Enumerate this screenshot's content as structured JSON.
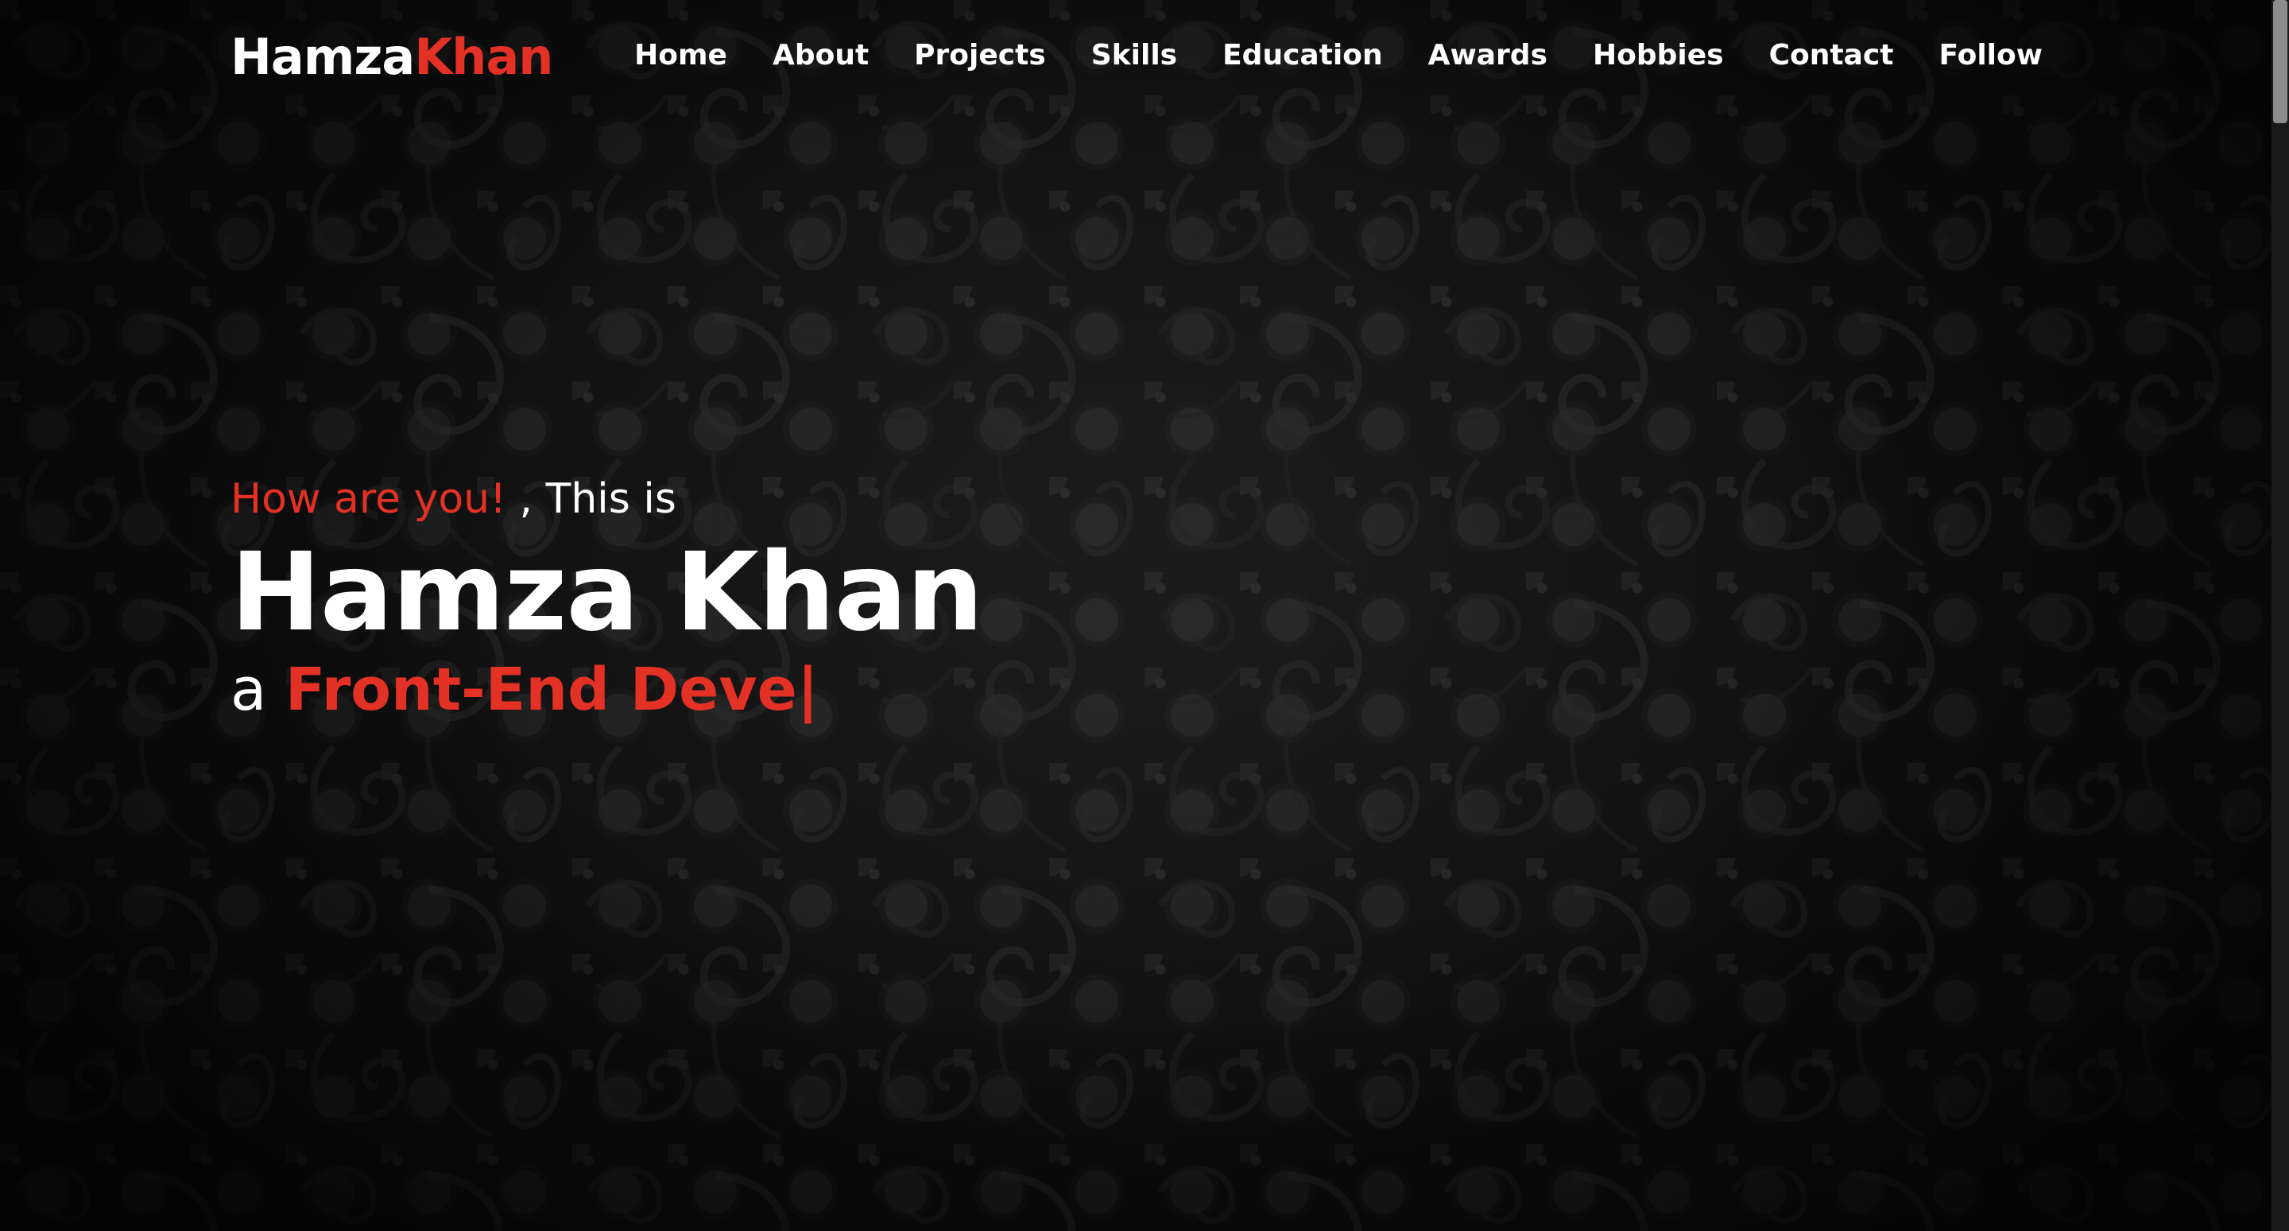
{
  "brand": {
    "first": "Hamza",
    "second": "Khan"
  },
  "nav": {
    "items": [
      {
        "label": "Home"
      },
      {
        "label": "About"
      },
      {
        "label": "Projects"
      },
      {
        "label": "Skills"
      },
      {
        "label": "Education"
      },
      {
        "label": "Awards"
      },
      {
        "label": "Hobbies"
      },
      {
        "label": "Contact"
      },
      {
        "label": "Follow"
      }
    ]
  },
  "hero": {
    "greeting_accent": "How are you!",
    "greeting_rest": " , This is",
    "name": "Hamza Khan",
    "role_prefix": "a ",
    "role_typed": "Front-End Deve",
    "cursor": "|"
  },
  "colors": {
    "accent": "#e33125",
    "text": "#ffffff",
    "background": "#101010"
  },
  "scrollbar": {
    "position": 0
  }
}
